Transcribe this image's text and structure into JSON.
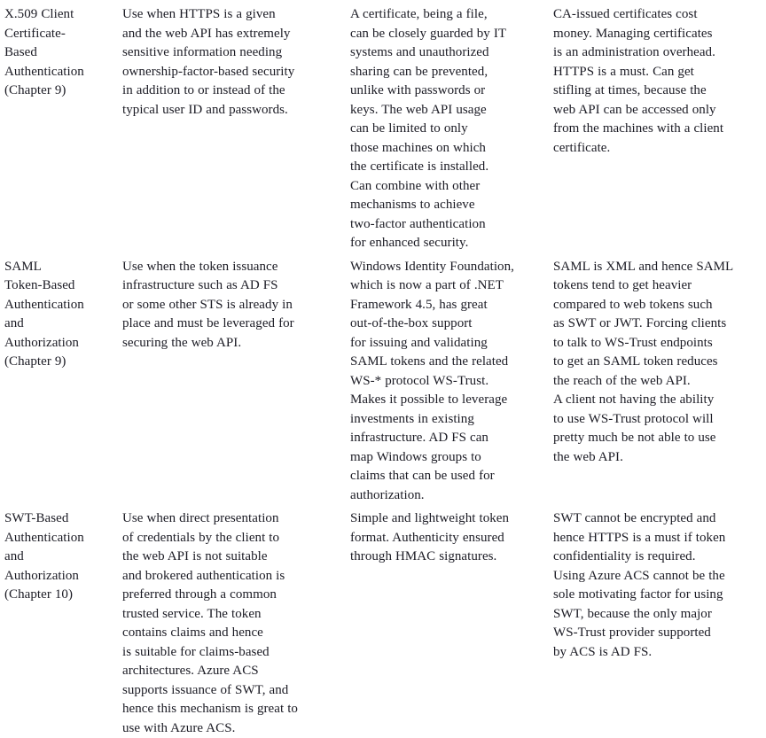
{
  "document": {
    "type": "comparison-table",
    "background_color": "#ffffff",
    "text_color": "#1b1b24",
    "columns": 4,
    "rows": 3
  },
  "table": {
    "rows": [
      {
        "mechanism": {
          "lines": [
            "X.509 Client",
            "Certificate-",
            "Based",
            "Authentication",
            "(Chapter 9)"
          ]
        },
        "use_when": {
          "lines": [
            "Use when HTTPS is a given",
            "and the web API has extremely",
            "sensitive information needing",
            "ownership-factor-based security",
            "in addition to or instead of the",
            "typical user ID and passwords."
          ]
        },
        "pros": {
          "lines": [
            "A certificate, being a file,",
            "can be closely guarded by IT",
            "systems and unauthorized",
            "sharing can be prevented,",
            "unlike with passwords or",
            "keys. The web API usage",
            "can be limited to only",
            "those machines on which",
            "the certificate is installed.",
            "Can combine with other",
            "mechanisms to achieve",
            "two-factor authentication",
            "for enhanced security."
          ]
        },
        "cons": {
          "lines": [
            "CA-issued certificates cost",
            "money. Managing certificates",
            "is an administration overhead.",
            "HTTPS is a must. Can get",
            "stifling at times, because the",
            "web API can be accessed only",
            "from the machines with a client",
            "certificate."
          ]
        }
      },
      {
        "mechanism": {
          "lines": [
            "SAML",
            "Token-Based",
            "Authentication",
            "and",
            "Authorization",
            "(Chapter 9)"
          ]
        },
        "use_when": {
          "lines": [
            "Use when the token issuance",
            "infrastructure such as AD FS",
            "or some other STS is already in",
            "place and must be leveraged for",
            "securing the web API."
          ]
        },
        "pros": {
          "lines": [
            "Windows Identity Foundation,",
            "which is now a part of .NET",
            "Framework 4.5, has great",
            "out-of-the-box support",
            "for issuing and validating",
            "SAML tokens and the related",
            "WS-* protocol WS-Trust.",
            "Makes it possible to leverage",
            "investments in existing",
            "infrastructure. AD FS can",
            "map Windows groups to",
            "claims that can be used for",
            "authorization."
          ]
        },
        "cons": {
          "lines": [
            "SAML is XML and hence SAML",
            "tokens tend to get heavier",
            "compared to web tokens such",
            "as SWT or JWT. Forcing clients",
            "to talk to WS-Trust endpoints",
            "to get an SAML token reduces",
            "the reach of the web API.",
            "A client not having the ability",
            "to use WS-Trust protocol will",
            "pretty much be not able to use",
            "the web API."
          ]
        }
      },
      {
        "mechanism": {
          "lines": [
            "SWT-Based",
            "Authentication",
            "and",
            "Authorization",
            "(Chapter 10)"
          ]
        },
        "use_when": {
          "lines": [
            "Use when direct presentation",
            "of credentials by the client to",
            "the web API is not suitable",
            "and brokered authentication is",
            "preferred through a common",
            "trusted service. The token",
            "contains claims and hence",
            "is suitable for claims-based",
            "architectures. Azure ACS",
            "supports issuance of SWT, and",
            "hence this mechanism is great to",
            "use with Azure ACS."
          ]
        },
        "pros": {
          "lines": [
            "Simple and lightweight token",
            "format. Authenticity ensured",
            "through HMAC signatures."
          ]
        },
        "cons": {
          "lines": [
            "SWT cannot be encrypted and",
            "hence HTTPS is a must if token",
            "confidentiality is required.",
            "Using Azure ACS cannot be the",
            "sole motivating factor for using",
            "SWT, because the only major",
            "WS-Trust provider supported",
            "by ACS is AD FS."
          ]
        }
      }
    ]
  }
}
